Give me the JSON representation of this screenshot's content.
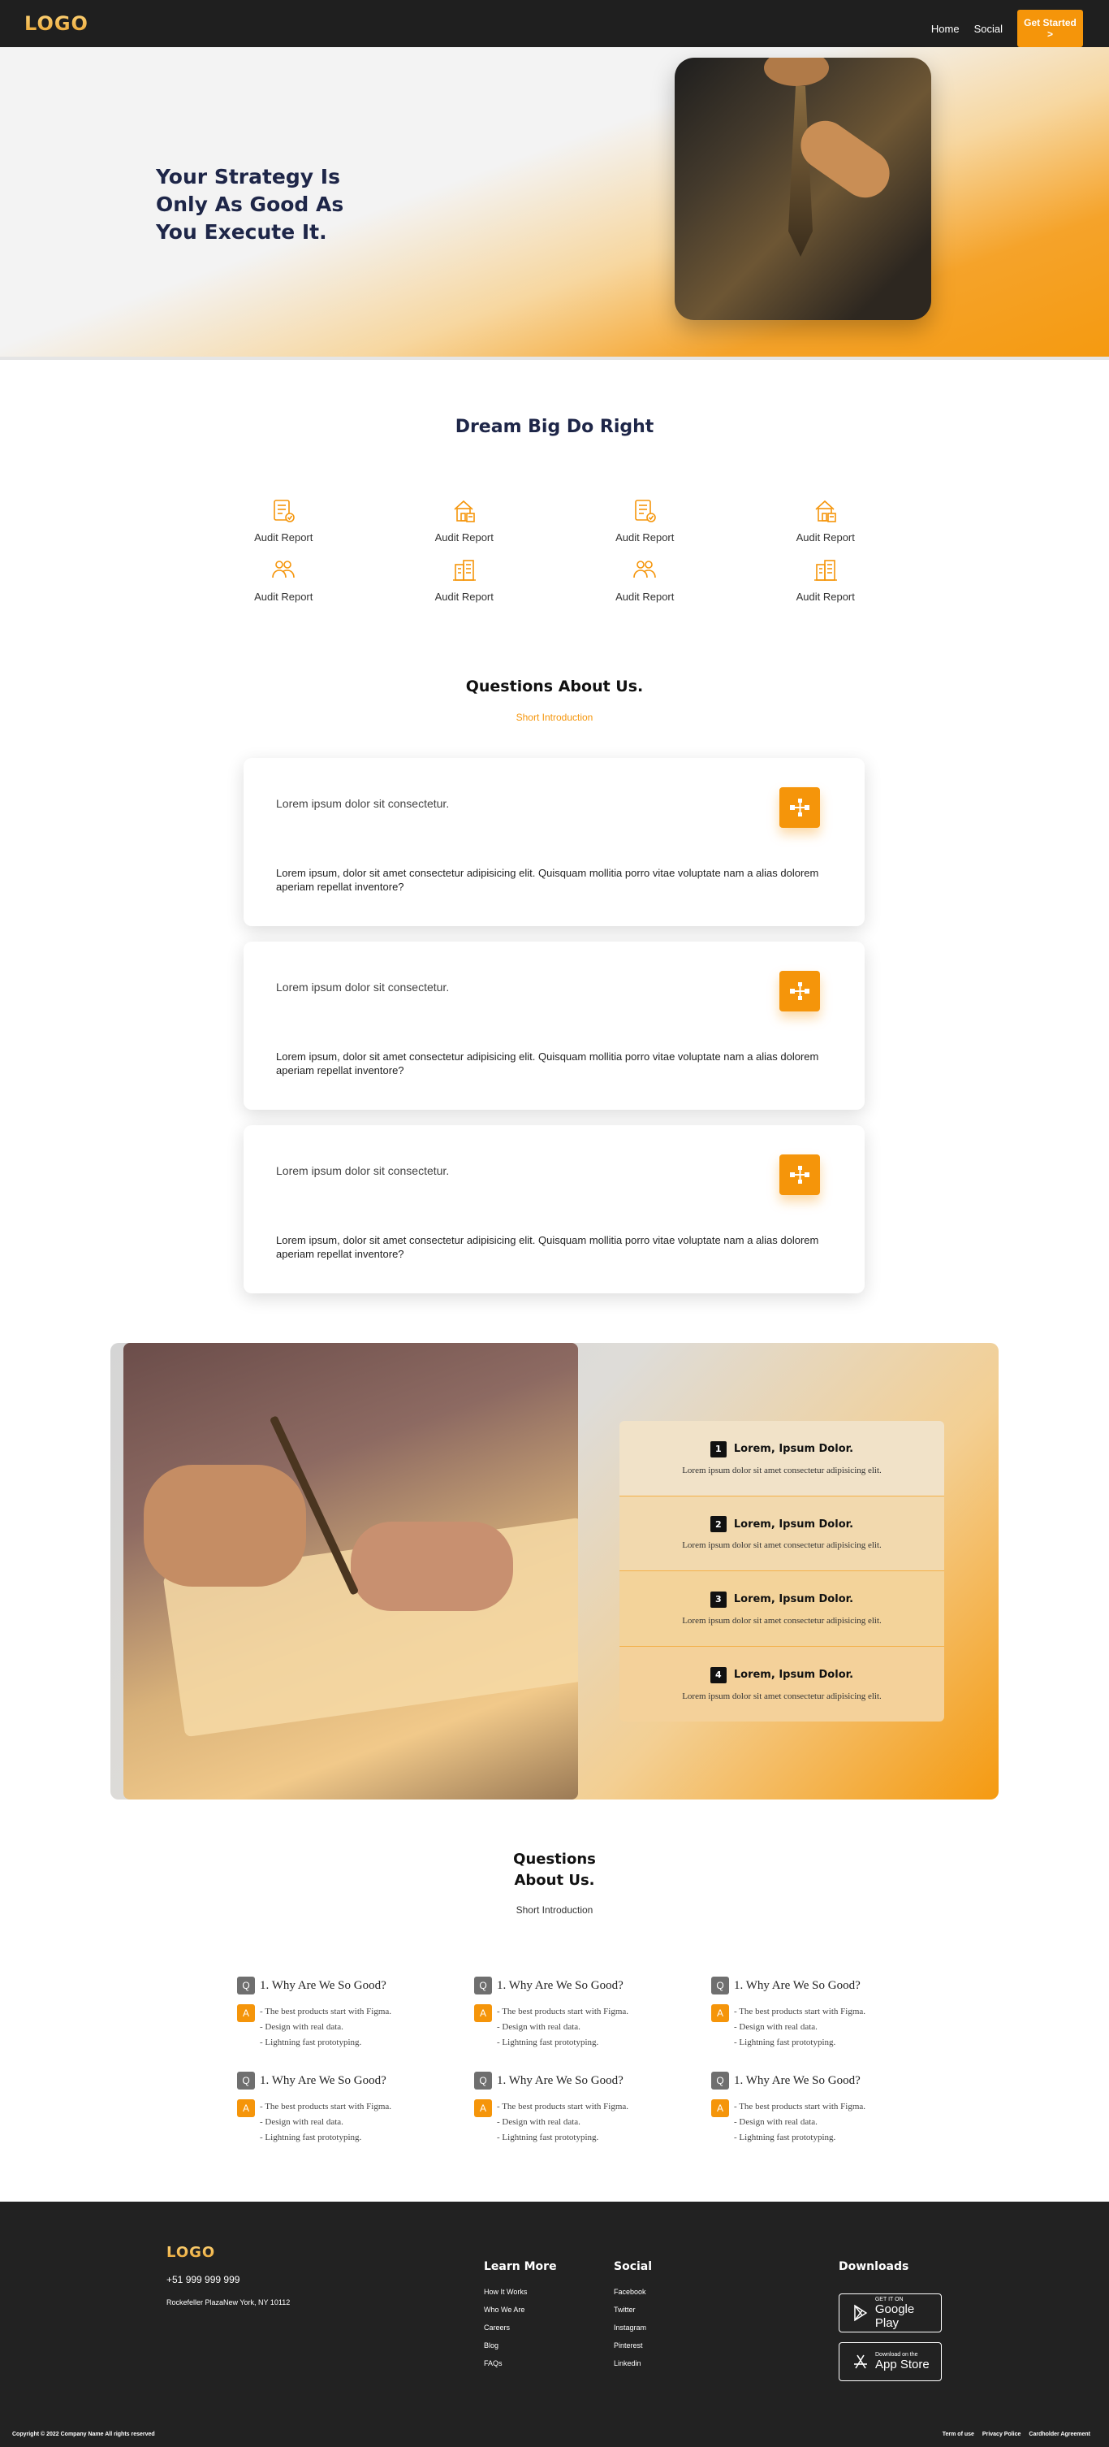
{
  "nav": {
    "logo": "LOGO",
    "links": [
      "Home",
      "Social"
    ],
    "cta": "Get Started >"
  },
  "hero": {
    "title": "Your Strategy Is Only As Good As You Execute It."
  },
  "features": {
    "title": "Dream Big Do Right",
    "items": [
      {
        "label": "Audit Report",
        "icon": "report-icon"
      },
      {
        "label": "Audit Report",
        "icon": "house-icon"
      },
      {
        "label": "Audit Report",
        "icon": "report-icon"
      },
      {
        "label": "Audit Report",
        "icon": "house-icon"
      },
      {
        "label": "Audit Report",
        "icon": "people-icon"
      },
      {
        "label": "Audit Report",
        "icon": "building-icon"
      },
      {
        "label": "Audit Report",
        "icon": "people-icon"
      },
      {
        "label": "Audit Report",
        "icon": "building-icon"
      }
    ]
  },
  "questions": {
    "title": "Questions About Us.",
    "subtitle": "Short Introduction",
    "cards": [
      {
        "question": "Lorem ipsum dolor sit consectetur.",
        "answer": "Lorem ipsum, dolor sit amet consectetur adipisicing elit. Quisquam mollitia porro vitae voluptate nam a alias dolorem aperiam repellat inventore?"
      },
      {
        "question": "Lorem ipsum dolor sit consectetur.",
        "answer": "Lorem ipsum, dolor sit amet consectetur adipisicing elit. Quisquam mollitia porro vitae voluptate nam a alias dolorem aperiam repellat inventore?"
      },
      {
        "question": "Lorem ipsum dolor sit consectetur.",
        "answer": "Lorem ipsum, dolor sit amet consectetur adipisicing elit. Quisquam mollitia porro vitae voluptate nam a alias dolorem aperiam repellat inventore?"
      }
    ]
  },
  "steps": [
    {
      "num": "1",
      "title": "Lorem, Ipsum Dolor.",
      "text": "Lorem ipsum dolor sit amet consectetur adipisicing elit."
    },
    {
      "num": "2",
      "title": "Lorem, Ipsum Dolor.",
      "text": "Lorem ipsum dolor sit amet consectetur adipisicing elit."
    },
    {
      "num": "3",
      "title": "Lorem, Ipsum Dolor.",
      "text": "Lorem ipsum dolor sit amet consectetur adipisicing elit."
    },
    {
      "num": "4",
      "title": "Lorem, Ipsum Dolor.",
      "text": "Lorem ipsum dolor sit amet consectetur adipisicing elit."
    }
  ],
  "faq": {
    "title_line1": "Questions",
    "title_line2": "About Us.",
    "subtitle": "Short Introduction",
    "q_badge": "Q",
    "a_badge": "A",
    "items": [
      {
        "question": "1. Why Are We So Good?",
        "lines": [
          "- The best products start with Figma.",
          "- Design with real data.",
          "- Lightning fast prototyping."
        ]
      },
      {
        "question": "1. Why Are We So Good?",
        "lines": [
          "- The best products start with Figma.",
          "- Design with real data.",
          "- Lightning fast prototyping."
        ]
      },
      {
        "question": "1. Why Are We So Good?",
        "lines": [
          "- The best products start with Figma.",
          "- Design with real data.",
          "- Lightning fast prototyping."
        ]
      },
      {
        "question": "1. Why Are We So Good?",
        "lines": [
          "- The best products start with Figma.",
          "- Design with real data.",
          "- Lightning fast prototyping."
        ]
      },
      {
        "question": "1. Why Are We So Good?",
        "lines": [
          "- The best products start with Figma.",
          "- Design with real data.",
          "- Lightning fast prototyping."
        ]
      },
      {
        "question": "1. Why Are We So Good?",
        "lines": [
          "- The best products start with Figma.",
          "- Design with real data.",
          "- Lightning fast prototyping."
        ]
      }
    ]
  },
  "footer": {
    "logo": "LOGO",
    "phone": "+51 999 999 999",
    "address": "Rockefeller PlazaNew York, NY 10112",
    "learn_more": {
      "title": "Learn More",
      "links": [
        "How It Works",
        "Who We Are",
        "Careers",
        "Blog",
        "FAQs"
      ]
    },
    "social": {
      "title": "Social",
      "links": [
        "Facebook",
        "Twitter",
        "Instagram",
        "Pinterest",
        "Linkedin"
      ]
    },
    "downloads": {
      "title": "Downloads",
      "google_play": {
        "small": "GET IT ON",
        "big": "Google Play"
      },
      "app_store": {
        "small": "Download on the",
        "big": "App Store"
      }
    },
    "copyright": "Copyright © 2022 Company Name All rights reserved",
    "legal": [
      "Term of use",
      "Privacy Police",
      "Cardholder Agreement"
    ]
  },
  "colors": {
    "accent": "#f5950a",
    "dark": "#222222",
    "navy": "#1e2648"
  }
}
